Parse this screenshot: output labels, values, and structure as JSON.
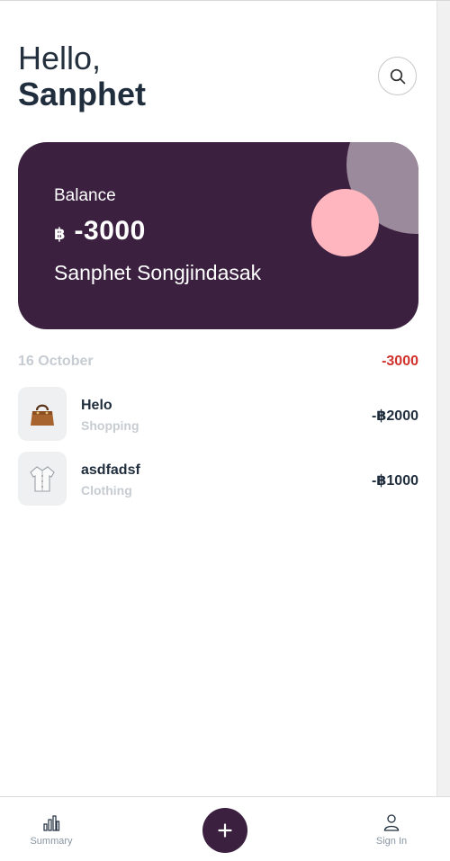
{
  "header": {
    "hello": "Hello,",
    "user_name": "Sanphet"
  },
  "card": {
    "balance_label": "Balance",
    "currency_symbol": "฿",
    "balance_value": "-3000",
    "holder_name": "Sanphet Songjindasak",
    "colors": {
      "background": "#3b2040",
      "circle_large": "#9b8a9b",
      "circle_small": "#ffb6bf"
    }
  },
  "transactions_group": {
    "date": "16 October",
    "total": "-3000",
    "total_color": "#d0312d",
    "items": [
      {
        "title": "Helo",
        "category": "Shopping",
        "amount": "-฿2000",
        "icon": "handbag-icon"
      },
      {
        "title": "asdfadsf",
        "category": "Clothing",
        "amount": "-฿1000",
        "icon": "shirt-icon"
      }
    ]
  },
  "bottom_nav": {
    "summary_label": "Summary",
    "add_icon": "plus-icon",
    "signin_label": "Sign In"
  }
}
